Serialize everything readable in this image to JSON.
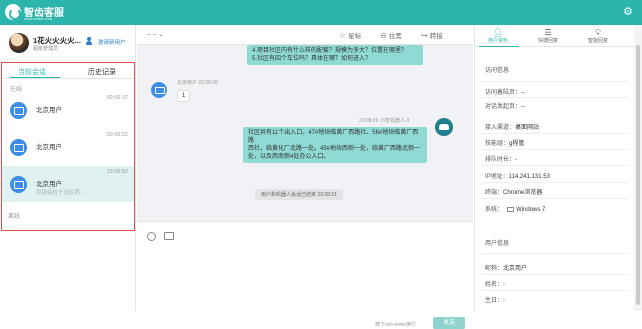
{
  "app": {
    "title": "智齿客服",
    "url": "www.sobot.com"
  },
  "profile": {
    "name": "1花火火火火...",
    "role": "超级管理员",
    "invite_label": "邀请新用户"
  },
  "sessions": {
    "tabs": [
      {
        "label": "当前会话"
      },
      {
        "label": "历史记录"
      }
    ],
    "group_online": "在线",
    "group_offline": "离线",
    "items": [
      {
        "name": "北京用户",
        "time": "00:00:37",
        "preview": ""
      },
      {
        "name": "北京用户",
        "time": "00:00:22",
        "preview": ""
      },
      {
        "name": "北京用户",
        "time": "23:58:52",
        "preview": "垃圾站位于社区西..."
      }
    ]
  },
  "chat": {
    "title": "-- --",
    "actions": [
      {
        "label": "星标",
        "icon": "star-icon"
      },
      {
        "label": "拉黑",
        "icon": "block-icon"
      },
      {
        "label": "转接",
        "icon": "transfer-icon"
      }
    ],
    "messages": {
      "top_bubble_line1": "4.项目社区内有什么样的配套？规模为多大？位置在哪里？",
      "top_bubble_line2": "5.社区有四个车位吗？具体在哪？如何进入？",
      "visitor_time": "北京用户  23:08:26",
      "visitor_text": "1",
      "robot_meta": "23:08:26  小智机器人-3",
      "robot_line1": "社区共有11个出入口。47#地块临黄厂西路社、56#地块临黄厂西路",
      "robot_line2": "西社，临黄化厂北路一处。45#地块西侧一处，临黄厂西路北侧一",
      "robot_line3": "处，以及西南侧4处办公入口。",
      "system_note": "用户和机器人会话已结束 23:08:31"
    },
    "send_hint": "按下ctrl+enter换行",
    "send_label": "发送"
  },
  "right": {
    "tabs": [
      {
        "label": "用户资料",
        "icon": "user-icon"
      },
      {
        "label": "快捷回复",
        "icon": "list-icon"
      },
      {
        "label": "智能回复",
        "icon": "bulb-icon"
      }
    ],
    "visit_title": "访问信息",
    "visit_rows": [
      {
        "label": "访问着陆页：",
        "value": "--"
      },
      {
        "label": "对话发起页：",
        "value": "--"
      },
      {
        "label": "接入渠道：",
        "value": "桌面网站"
      },
      {
        "label": "技能组：",
        "value": "g程管"
      },
      {
        "label": "排队时长：",
        "value": "-"
      },
      {
        "label": "IP地址：",
        "value": "114.241.131.53"
      },
      {
        "label": "终端：",
        "value": "Chrome浏览器"
      },
      {
        "label": "系统：",
        "value": "Windows 7"
      }
    ],
    "user_title": "用户信息",
    "user_rows": [
      {
        "label": "昵称：",
        "value": "北京用户"
      },
      {
        "label": "姓名：",
        "value": "-"
      },
      {
        "label": "生日：",
        "value": "-"
      }
    ]
  }
}
